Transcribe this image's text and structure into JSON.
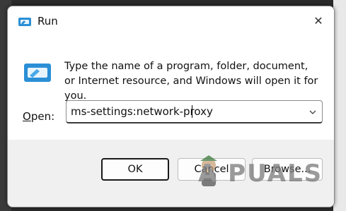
{
  "window": {
    "title": "Run",
    "close_symbol": "✕"
  },
  "content": {
    "description": "Type the name of a program, folder, document, or Internet resource, and Windows will open it for you.",
    "open_label_accel": "O",
    "open_label_rest": "pen:",
    "open_value": "ms-settings:network-proxy"
  },
  "buttons": {
    "ok": "OK",
    "cancel": "Cancel",
    "browse": "Browse..."
  },
  "watermark": {
    "text": "A  PUALS"
  },
  "icons": {
    "title": "run-icon",
    "main": "run-icon-large",
    "dropdown": "chevron-down-icon",
    "close": "close-icon"
  },
  "colors": {
    "run_icon_blue": "#2b8fd6",
    "dialog_bg": "#ffffff",
    "footer_bg": "#f0f0f0"
  }
}
